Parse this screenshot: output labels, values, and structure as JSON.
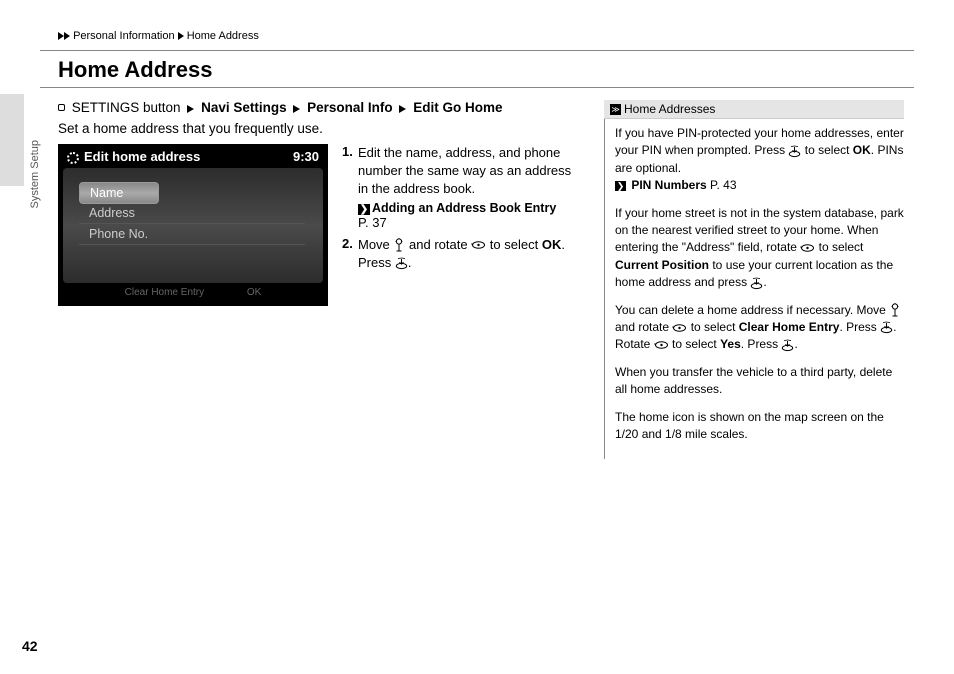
{
  "breadcrumb": {
    "item1": "Personal Information",
    "item2": "Home Address"
  },
  "title": "Home Address",
  "side_tab": "System Setup",
  "navpath": {
    "prefix": "SETTINGS button",
    "seg1": "Navi Settings",
    "seg2": "Personal Info",
    "seg3": "Edit Go Home"
  },
  "intro": "Set a home address that you frequently use.",
  "screenshot": {
    "header": "Edit home address",
    "clock": "9:30",
    "row1": "Name",
    "row2": "Address",
    "row3": "Phone No.",
    "footer_left": "Clear Home Entry",
    "footer_right": "OK"
  },
  "steps": {
    "s1": "Edit the name, address, and phone number the same way as an address in the address book.",
    "s1_link": "Adding an Address Book Entry",
    "s1_page": "P. 37",
    "s2a": "Move ",
    "s2b": " and rotate ",
    "s2c": " to select ",
    "s2d": "OK",
    "s2e": ". Press ",
    "s2f": "."
  },
  "sidebar": {
    "head": "Home Addresses",
    "p1a": "If you have PIN-protected your home addresses, enter your PIN when prompted. Press ",
    "p1b": " to select ",
    "p1c": "OK",
    "p1d": ". PINs are optional.",
    "p1_link": "PIN Numbers",
    "p1_page": " P. 43",
    "p2a": "If your home street is not in the system database, park on the nearest verified street to your home. When entering the \"Address\" field, rotate ",
    "p2b": " to select ",
    "p2c": "Current Position",
    "p2d": " to use your current location as the home address and press ",
    "p2e": ".",
    "p3a": "You can delete a home address if necessary. Move ",
    "p3b": " and rotate ",
    "p3c": " to select ",
    "p3d": "Clear Home Entry",
    "p3e": ". Press ",
    "p3f": ". Rotate ",
    "p3g": " to select ",
    "p3h": "Yes",
    "p3i": ". Press ",
    "p3j": ".",
    "p4": "When you transfer the vehicle to a third party, delete all home addresses.",
    "p5": "The home icon is shown on the map screen on the 1/20 and 1/8 mile scales."
  },
  "page_number": "42"
}
